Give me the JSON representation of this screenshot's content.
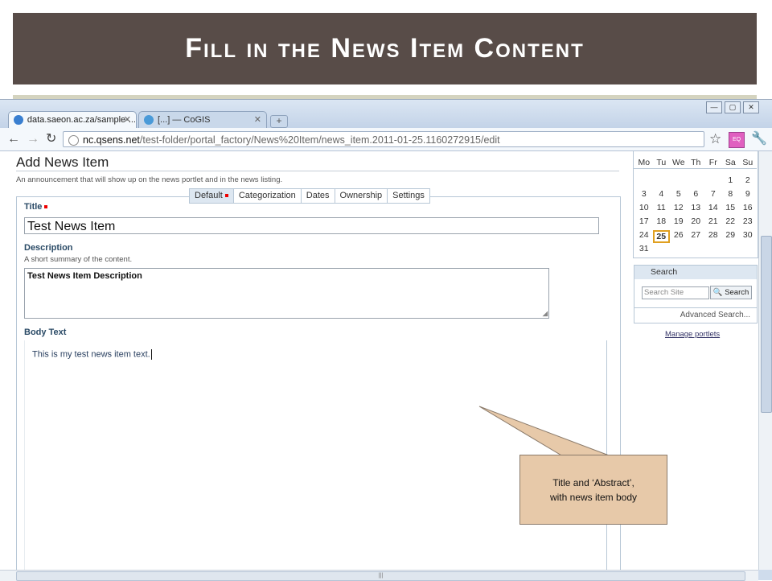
{
  "slide": {
    "title": "Fill in the News Item Content"
  },
  "browser": {
    "tabs": [
      {
        "label": "data.saeon.ac.za/sample-..."
      },
      {
        "label": "[...] — CoGIS"
      }
    ],
    "url_domain": "nc.qsens.net",
    "url_path": "/test-folder/portal_factory/News%20Item/news_item.2011-01-25.1160272915/edit"
  },
  "page": {
    "heading": "Add News Item",
    "lead": "An announcement that will show up on the news portlet and in the news listing.",
    "form_tabs": [
      "Default",
      "Categorization",
      "Dates",
      "Ownership",
      "Settings"
    ],
    "title_label": "Title",
    "title_value": "Test News Item",
    "description_label": "Description",
    "description_help": "A short summary of the content.",
    "description_value": "Test News Item Description",
    "body_label": "Body Text",
    "body_value": "This is my test news item text."
  },
  "calendar": {
    "days": [
      "Mo",
      "Tu",
      "We",
      "Th",
      "Fr",
      "Sa",
      "Su"
    ],
    "weeks": [
      [
        "",
        "",
        "",
        "",
        "",
        "1",
        "2"
      ],
      [
        "3",
        "4",
        "5",
        "6",
        "7",
        "8",
        "9"
      ],
      [
        "10",
        "11",
        "12",
        "13",
        "14",
        "15",
        "16"
      ],
      [
        "17",
        "18",
        "19",
        "20",
        "21",
        "22",
        "23"
      ],
      [
        "24",
        "25",
        "26",
        "27",
        "28",
        "29",
        "30"
      ],
      [
        "31",
        "",
        "",
        "",
        "",
        "",
        ""
      ]
    ],
    "today": "25"
  },
  "search": {
    "header": "Search",
    "placeholder": "Search Site",
    "button": "Search",
    "advanced": "Advanced Search..."
  },
  "manage_portlets": "Manage portlets",
  "callout": {
    "line1": "Title and ‘Abstract’,",
    "line2": "with news item body"
  }
}
